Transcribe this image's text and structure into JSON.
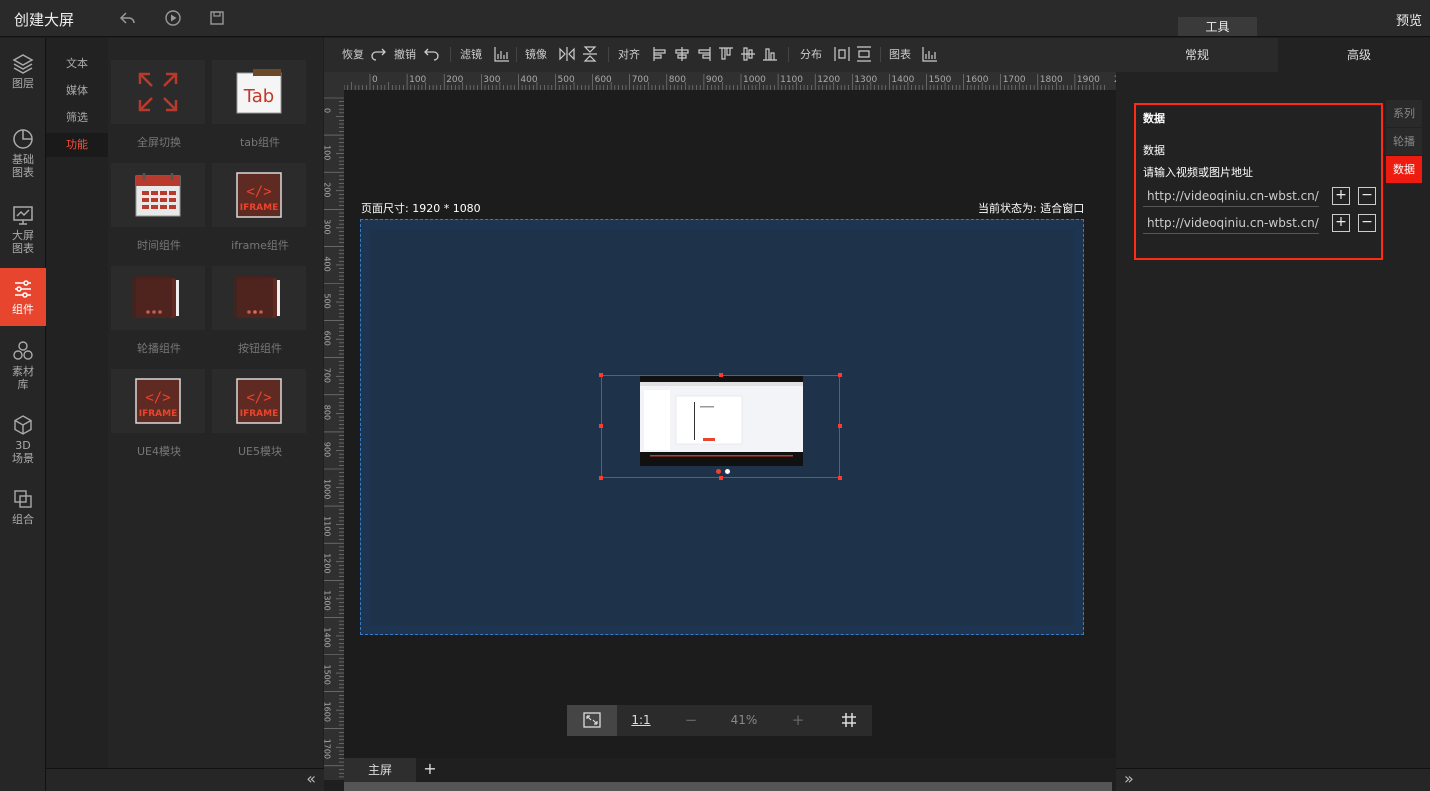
{
  "app": {
    "title": "创建大屏",
    "preview_label": "预览",
    "tools_label": "工具"
  },
  "nav": [
    {
      "label": "图层",
      "icon": "layers-icon"
    },
    {
      "label": "基础图表",
      "icon": "pie-chart-icon"
    },
    {
      "label": "大屏图表",
      "icon": "monitor-chart-icon"
    },
    {
      "label": "组件",
      "icon": "sliders-icon",
      "active": true
    },
    {
      "label": "素材库",
      "icon": "hexagons-icon"
    },
    {
      "label": "3D场景",
      "icon": "cube-icon"
    },
    {
      "label": "组合",
      "icon": "group-icon"
    }
  ],
  "categories": [
    {
      "label": "文本"
    },
    {
      "label": "媒体"
    },
    {
      "label": "筛选"
    },
    {
      "label": "功能",
      "active": true
    }
  ],
  "components": [
    {
      "label": "全屏切换",
      "icon": "fullscreen-icon"
    },
    {
      "label": "tab组件",
      "icon": "tab-icon",
      "text": "Tab"
    },
    {
      "label": "时间组件",
      "icon": "calendar-icon"
    },
    {
      "label": "iframe组件",
      "icon": "iframe-icon",
      "text": "IFRAME"
    },
    {
      "label": "轮播组件",
      "icon": "carousel-icon"
    },
    {
      "label": "按钮组件",
      "icon": "button-component-icon"
    },
    {
      "label": "UE4模块",
      "icon": "ue4-icon",
      "text": "IFRAME"
    },
    {
      "label": "UE5模块",
      "icon": "ue5-icon",
      "text": "IFRAME"
    }
  ],
  "toolbar": {
    "redo": "恢复",
    "undo": "撤销",
    "filter": "滤镜",
    "mirror": "镜像",
    "align": "对齐",
    "distribute": "分布",
    "chart": "图表"
  },
  "ruler_labels": [
    "0",
    "100",
    "200",
    "300",
    "400",
    "500",
    "600",
    "700",
    "800",
    "900",
    "1000",
    "1100",
    "1200",
    "1300",
    "1400",
    "1500",
    "1600",
    "1700",
    "1800",
    "1900",
    "20"
  ],
  "ruler_left_labels": [
    "0",
    "100",
    "200",
    "300",
    "400",
    "500",
    "600",
    "700",
    "800",
    "900",
    "1000",
    "1100",
    "1200",
    "1300",
    "1400",
    "1500",
    "1600",
    "1700"
  ],
  "canvas": {
    "page_size": "页面尺寸: 1920 * 1080",
    "state": "当前状态为: 适合窗口"
  },
  "zoom": {
    "fit": "fit-screen-icon",
    "one_to_one": "1:1",
    "minus": "−",
    "value": "41%",
    "plus": "+",
    "grid": "grid-icon"
  },
  "bottom": {
    "main_tab": "主屏",
    "add_tab": "+"
  },
  "right": {
    "tab_general": "常规",
    "tab_advanced": "高级",
    "section_title": "数据",
    "sub_title": "数据",
    "prompt": "请输入视频或图片地址",
    "urls": [
      "http://videoqiniu.cn-wbst.cn/",
      "http://videoqiniu.cn-wbst.cn/"
    ],
    "add": "+",
    "remove": "−",
    "side_tabs": [
      {
        "label": "系列"
      },
      {
        "label": "轮播"
      },
      {
        "label": "数据",
        "active": true
      }
    ]
  },
  "colors": {
    "accent": "#e8452f",
    "highlight_border": "#ff2b17",
    "canvas": "#1e324a",
    "icon_red": "#b83a2c"
  }
}
